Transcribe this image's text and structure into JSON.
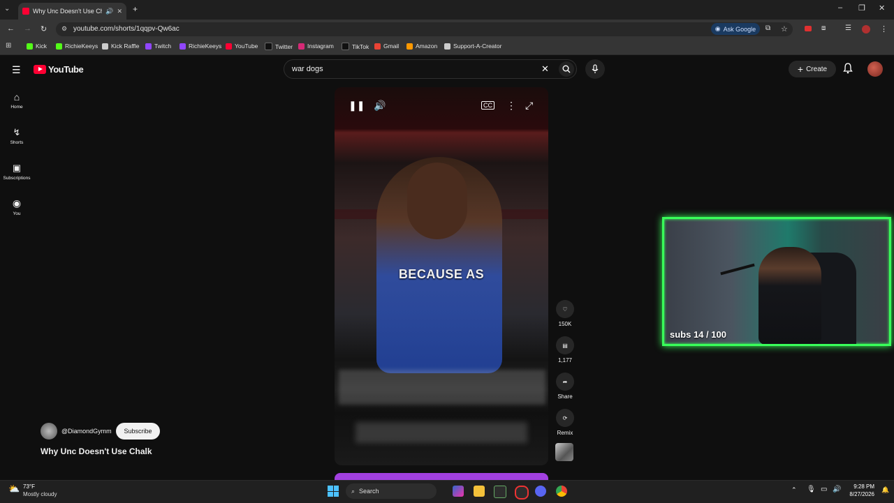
{
  "browser": {
    "tab_title": "Why Unc Doesn't Use Cha",
    "url": "youtube.com/shorts/1qqpv-Qw6ac",
    "ask_google": "Ask Google",
    "bookmarks": [
      "Kick",
      "RichieKeeys",
      "Kick Raffle",
      "Twitch",
      "RichieKeeys",
      "YouTube",
      "Twitter",
      "Instagram",
      "TikTok",
      "Gmail",
      "Amazon",
      "Support-A-Creator"
    ]
  },
  "youtube": {
    "logo": "YouTube",
    "search_query": "war dogs",
    "create_label": "Create",
    "nav": [
      "Home",
      "Shorts",
      "Subscriptions",
      "You"
    ]
  },
  "short": {
    "caption": "BECAUSE AS",
    "likes": "150K",
    "comments": "1,177",
    "share_label": "Share",
    "remix_label": "Remix",
    "channel": "@DiamondGymm",
    "subscribe_label": "Subscribe",
    "title": "Why Unc Doesn't Use Chalk"
  },
  "overlay": {
    "subs_text": "subs 14 / 100",
    "border_color": "#39ff5a"
  },
  "taskbar": {
    "temperature": "73°F",
    "weather": "Mostly cloudy",
    "search_label": "Search",
    "time": "9:28 PM",
    "date": "8/27/2026"
  }
}
